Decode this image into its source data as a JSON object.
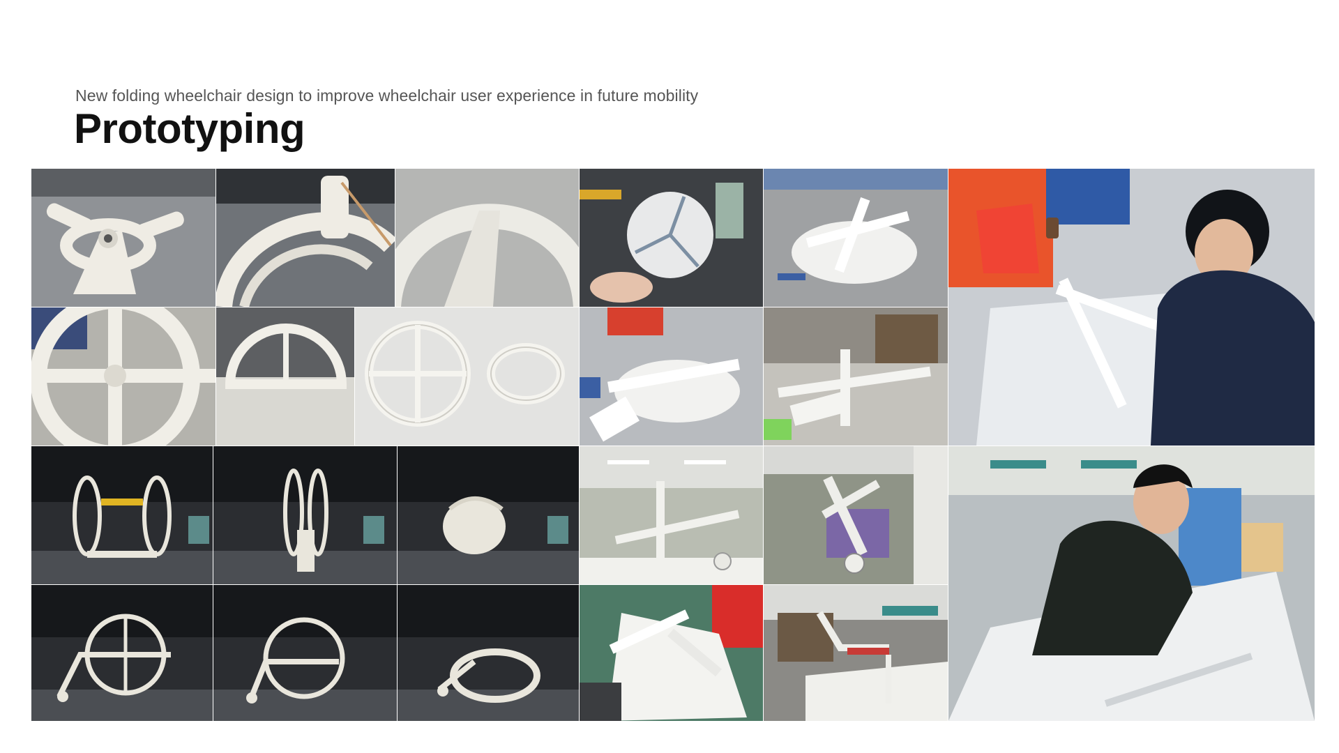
{
  "header": {
    "subtitle": "New folding wheelchair design to improve wheelchair user experience in future mobility",
    "title": "Prototyping"
  },
  "gallery": {
    "photos": [
      {
        "id": "p1",
        "subject": "white 3D-printed hub joint with arms",
        "bg": "#8f9296",
        "fg": "#f2f0ea"
      },
      {
        "id": "p2",
        "subject": "curved white wheel rim parts",
        "bg": "#6f7378",
        "fg": "#efece4"
      },
      {
        "id": "p3",
        "subject": "white wheel rim close-up",
        "bg": "#b5b6b4",
        "fg": "#ecebe5"
      },
      {
        "id": "p4",
        "subject": "paper disc model held in hand",
        "bg": "#3d4044",
        "fg": "#e8e9ea"
      },
      {
        "id": "p5",
        "subject": "foam board spokes on desk",
        "bg": "#9fa1a3",
        "fg": "#f1f1ef"
      },
      {
        "id": "p6",
        "subject": "person assembling foam board model",
        "bg": "#c9cdd2",
        "fg": "#1f2a44"
      },
      {
        "id": "p7",
        "subject": "white wheel hub with spokes",
        "bg": "#b4b3ad",
        "fg": "#f0eee7"
      },
      {
        "id": "p8",
        "subject": "half wheel rim",
        "bg": "#5d5f62",
        "fg": "#f1efe8"
      },
      {
        "id": "p9",
        "subject": "round wheel and folded wheel parts",
        "bg": "#e3e3e1",
        "fg": "#f5f4ef"
      },
      {
        "id": "p10",
        "subject": "foam board mechanism on desk",
        "bg": "#b8bbbf",
        "fg": "#f2f2f0"
      },
      {
        "id": "p11",
        "subject": "foam board spokes model",
        "bg": "#c4c2bc",
        "fg": "#f4f4f1"
      },
      {
        "id": "p12",
        "subject": "white wheelchair model front view",
        "bg": "#2b2d31",
        "fg": "#e9e6dc"
      },
      {
        "id": "p13",
        "subject": "white wheelchair model partly folded",
        "bg": "#2b2d31",
        "fg": "#e9e6dc"
      },
      {
        "id": "p14",
        "subject": "white wheelchair model folded",
        "bg": "#2b2d31",
        "fg": "#e9e6dc"
      },
      {
        "id": "p15",
        "subject": "foam board frame in office",
        "bg": "#b9bdb2",
        "fg": "#f1f1ed"
      },
      {
        "id": "p16",
        "subject": "foam board frame with wheels",
        "bg": "#8f9487",
        "fg": "#eeeeea"
      },
      {
        "id": "p17",
        "subject": "person working on foam board model",
        "bg": "#b9bfc2",
        "fg": "#1f2521"
      },
      {
        "id": "p18",
        "subject": "white wheelchair model side view",
        "bg": "#2b2d31",
        "fg": "#e9e6dc"
      },
      {
        "id": "p19",
        "subject": "white wheelchair model side view folding",
        "bg": "#2b2d31",
        "fg": "#e9e6dc"
      },
      {
        "id": "p20",
        "subject": "white wheelchair model fully folded",
        "bg": "#2b2d31",
        "fg": "#e9e6dc"
      },
      {
        "id": "p21",
        "subject": "pile of foam board cut pieces",
        "bg": "#4d7a66",
        "fg": "#f3f3f0"
      },
      {
        "id": "p22",
        "subject": "foam board frame on office table",
        "bg": "#8b8a86",
        "fg": "#f0f0ec"
      }
    ]
  }
}
